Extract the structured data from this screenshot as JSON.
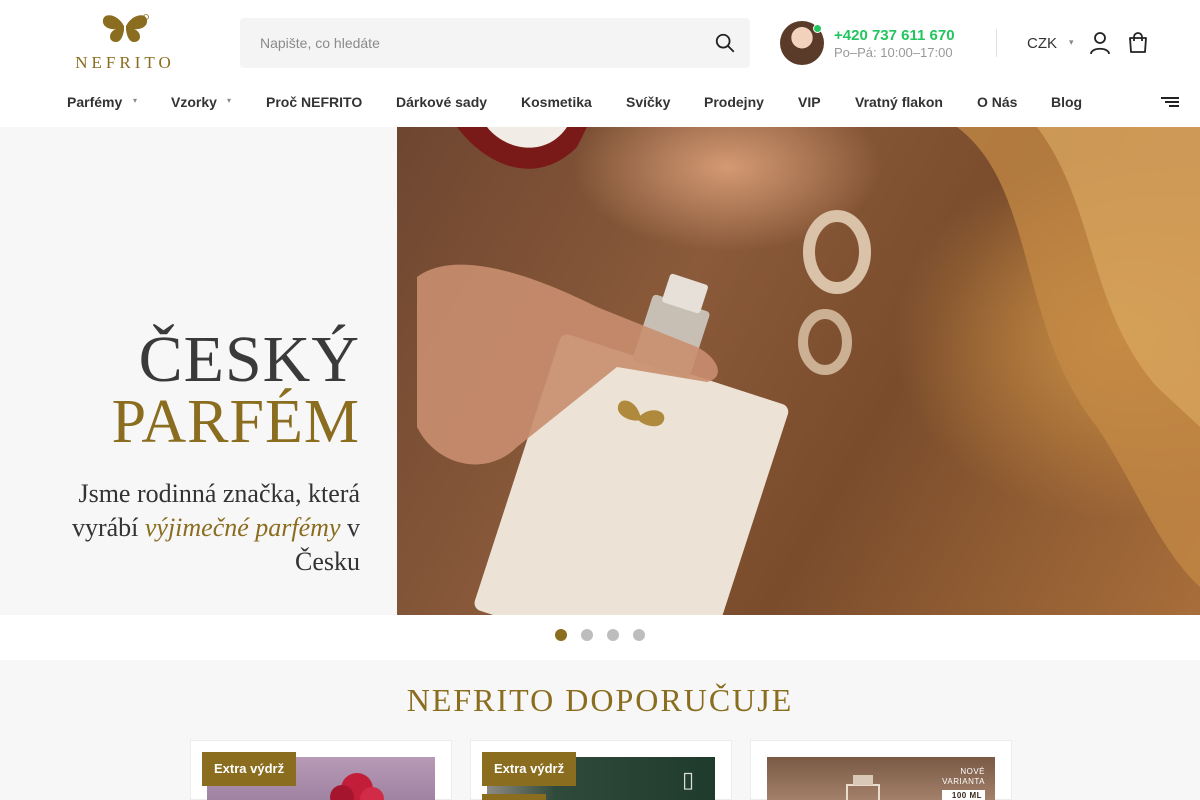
{
  "brand": {
    "name": "NEFRITO",
    "accent": "#8a6d1f"
  },
  "search": {
    "placeholder": "Napište, co hledáte"
  },
  "contact": {
    "phone": "+420 737 611 670",
    "hours": "Po–Pá: 10:00–17:00",
    "online_color": "#22c55e"
  },
  "currency": {
    "selected": "CZK"
  },
  "nav": {
    "items": [
      {
        "label": "Parfémy",
        "has_dropdown": true
      },
      {
        "label": "Vzorky",
        "has_dropdown": true
      },
      {
        "label": "Proč NEFRITO"
      },
      {
        "label": "Dárkové sady"
      },
      {
        "label": "Kosmetika"
      },
      {
        "label": "Svíčky"
      },
      {
        "label": "Prodejny"
      },
      {
        "label": "VIP"
      },
      {
        "label": "Vratný flakon"
      },
      {
        "label": "O Nás"
      },
      {
        "label": "Blog"
      }
    ]
  },
  "hero": {
    "headline_line1": "ČESKÝ",
    "headline_line2": "PARFÉM",
    "sub_part1": "Jsme rodinná značka, která vyrábí",
    "sub_em": "výjimečné parfémy",
    "sub_part2": "v Česku",
    "slides_total": 4,
    "slide_active": 1
  },
  "recommend": {
    "title": "NEFRITO DOPORUČUJE",
    "cards": [
      {
        "badge": "Extra výdrž"
      },
      {
        "badge": "Extra výdrž"
      },
      {
        "tag_line1": "NOVÉ",
        "tag_line2": "VARIANTA",
        "tag_volume": "100 ML"
      }
    ]
  }
}
